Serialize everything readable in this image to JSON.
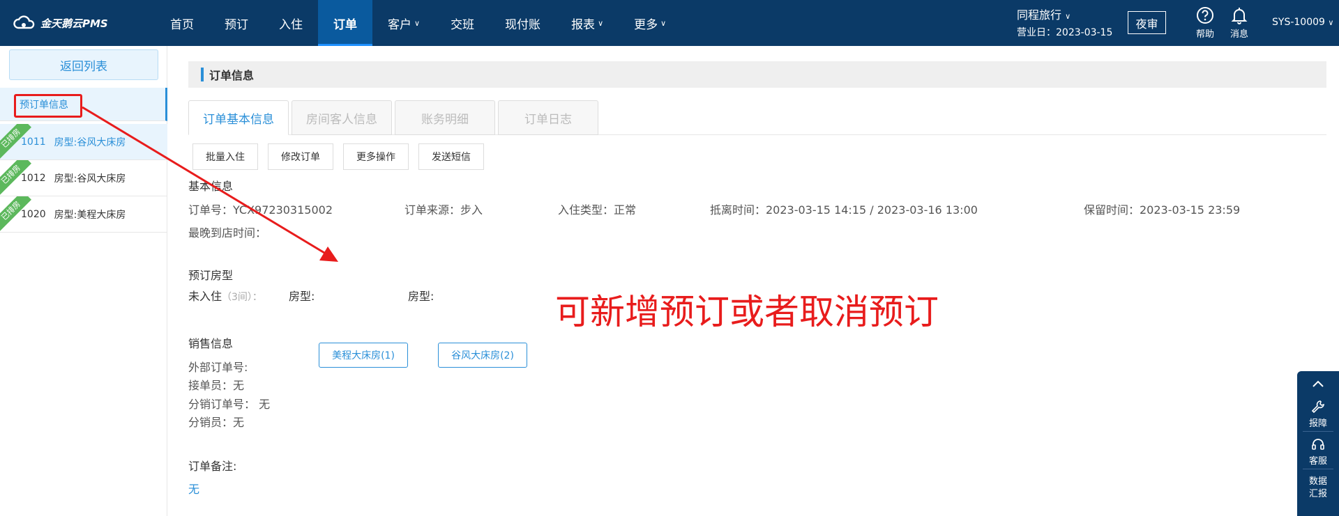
{
  "app": {
    "logo_text": "金天鹅云PMS"
  },
  "nav": {
    "items": [
      {
        "label": "首页"
      },
      {
        "label": "预订"
      },
      {
        "label": "入住"
      },
      {
        "label": "订单"
      },
      {
        "label": "客户"
      },
      {
        "label": "交班"
      },
      {
        "label": "现付账"
      },
      {
        "label": "报表"
      },
      {
        "label": "更多"
      }
    ],
    "active_index": 3
  },
  "header": {
    "hotel": "同程旅行",
    "business_day_label": "营业日：2023-03-15",
    "night_audit": "夜审",
    "help": "帮助",
    "messages": "消息",
    "user": "SYS-10009"
  },
  "sidebar": {
    "back_label": "返回列表",
    "order_info_label": "预订单信息",
    "rooms": [
      {
        "number": "1011",
        "type": "房型:谷风大床房",
        "ribbon": "已排房"
      },
      {
        "number": "1012",
        "type": "房型:谷风大床房",
        "ribbon": "已排房"
      },
      {
        "number": "1020",
        "type": "房型:美程大床房",
        "ribbon": "已排房"
      }
    ]
  },
  "order": {
    "section_title": "订单信息",
    "tabs": [
      {
        "label": "订单基本信息"
      },
      {
        "label": "房间客人信息"
      },
      {
        "label": "账务明细"
      },
      {
        "label": "订单日志"
      }
    ],
    "actions": [
      {
        "label": "批量入住"
      },
      {
        "label": "修改订单"
      },
      {
        "label": "更多操作"
      },
      {
        "label": "发送短信"
      }
    ],
    "basic_title": "基本信息",
    "order_no": "订单号：YCX97230315002",
    "source": "订单来源：步入",
    "checkin_type": "入住类型：正常",
    "arrive_leave": "抵离时间：2023-03-15 14:15 / 2023-03-16 13:00",
    "hold_time": "保留时间：2023-03-15 23:59",
    "latest_arrival": "最晚到店时间：",
    "reserved_title": "预订房型",
    "not_checked_in": "未入住",
    "room_count": "（3间）：",
    "room_type_label": "房型:",
    "room_types": [
      {
        "label": "美程大床房(1)"
      },
      {
        "label": "谷风大床房(2)"
      }
    ],
    "sales_title": "销售信息",
    "external_order_no": "外部订单号:",
    "receiver": "接单员：无",
    "distribution_order_no": "分销订单号：  无",
    "distributor": "分销员：无",
    "remark_title": "订单备注:",
    "remark_value": "无"
  },
  "annotation": {
    "text": "可新增预订或者取消预订",
    "color": "#e81c1c"
  },
  "fab": {
    "items": [
      {
        "label": "报障"
      },
      {
        "label": "客服"
      },
      {
        "label": "数据汇报"
      }
    ]
  },
  "colors": {
    "topbar": "#0b3a67",
    "accent": "#2a8fd8",
    "ribbon": "#5cb85c"
  }
}
